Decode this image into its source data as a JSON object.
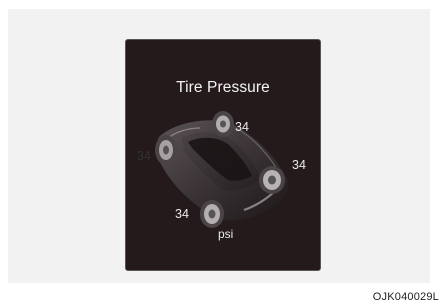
{
  "display": {
    "title": "Tire Pressure",
    "unit": "psi",
    "tires": {
      "front_left": "34",
      "front_right": "34",
      "rear_left": "34",
      "rear_right": "34"
    }
  },
  "figure_code": "OJK040029L"
}
